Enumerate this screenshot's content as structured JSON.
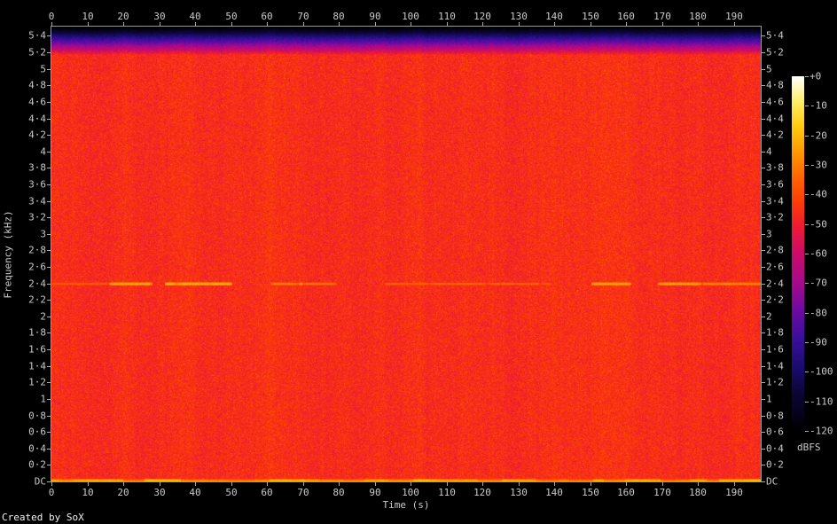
{
  "credit": "Created by SoX",
  "colors": {
    "background": "#000000",
    "axis_line": "#989898",
    "tick": "#aaaaaa",
    "label_text": "#cacaca",
    "credit_text": "#f2f2f2"
  },
  "chart_data": {
    "type": "heatmap",
    "subtype": "audio-spectrogram",
    "title": "",
    "xlabel": "Time (s)",
    "ylabel": "Frequency (kHz)",
    "colorbar_label": "dBFS",
    "x_range_s": [
      0,
      197.5
    ],
    "y_range_khz": [
      0,
      5.5125
    ],
    "colorbar_range_db": [
      0,
      -120
    ],
    "grid": false,
    "noise_floor_dbfs": -46,
    "x_ticks": [
      {
        "label": "0",
        "s": 0
      },
      {
        "label": "10",
        "s": 10
      },
      {
        "label": "20",
        "s": 20
      },
      {
        "label": "30",
        "s": 30
      },
      {
        "label": "40",
        "s": 40
      },
      {
        "label": "50",
        "s": 50
      },
      {
        "label": "60",
        "s": 60
      },
      {
        "label": "70",
        "s": 70
      },
      {
        "label": "80",
        "s": 80
      },
      {
        "label": "90",
        "s": 90
      },
      {
        "label": "100",
        "s": 100
      },
      {
        "label": "110",
        "s": 110
      },
      {
        "label": "120",
        "s": 120
      },
      {
        "label": "130",
        "s": 130
      },
      {
        "label": "140",
        "s": 140
      },
      {
        "label": "150",
        "s": 150
      },
      {
        "label": "160",
        "s": 160
      },
      {
        "label": "170",
        "s": 170
      },
      {
        "label": "180",
        "s": 180
      },
      {
        "label": "190",
        "s": 190
      }
    ],
    "y_ticks": [
      {
        "label": "5·4",
        "khz": 5.4
      },
      {
        "label": "5·2",
        "khz": 5.2
      },
      {
        "label": "5",
        "khz": 5.0
      },
      {
        "label": "4·8",
        "khz": 4.8
      },
      {
        "label": "4·6",
        "khz": 4.6
      },
      {
        "label": "4·4",
        "khz": 4.4
      },
      {
        "label": "4·2",
        "khz": 4.2
      },
      {
        "label": "4",
        "khz": 4.0
      },
      {
        "label": "3·8",
        "khz": 3.8
      },
      {
        "label": "3·6",
        "khz": 3.6
      },
      {
        "label": "3·4",
        "khz": 3.4
      },
      {
        "label": "3·2",
        "khz": 3.2
      },
      {
        "label": "3",
        "khz": 3.0
      },
      {
        "label": "2·8",
        "khz": 2.8
      },
      {
        "label": "2·6",
        "khz": 2.6
      },
      {
        "label": "2·4",
        "khz": 2.4
      },
      {
        "label": "2·2",
        "khz": 2.2
      },
      {
        "label": "2",
        "khz": 2.0
      },
      {
        "label": "1·8",
        "khz": 1.8
      },
      {
        "label": "1·6",
        "khz": 1.6
      },
      {
        "label": "1·4",
        "khz": 1.4
      },
      {
        "label": "1·2",
        "khz": 1.2
      },
      {
        "label": "1",
        "khz": 1.0
      },
      {
        "label": "0·8",
        "khz": 0.8
      },
      {
        "label": "0·6",
        "khz": 0.6
      },
      {
        "label": "0·4",
        "khz": 0.4
      },
      {
        "label": "0·2",
        "khz": 0.2
      },
      {
        "label": "DC",
        "khz": 0
      }
    ],
    "colorbar_ticks": [
      {
        "label": "+0",
        "db": 0
      },
      {
        "label": "-10",
        "db": -10
      },
      {
        "label": "-20",
        "db": -20
      },
      {
        "label": "-30",
        "db": -30
      },
      {
        "label": "-40",
        "db": -40
      },
      {
        "label": "-50",
        "db": -50
      },
      {
        "label": "-60",
        "db": -60
      },
      {
        "label": "-70",
        "db": -70
      },
      {
        "label": "-80",
        "db": -80
      },
      {
        "label": "-90",
        "db": -90
      },
      {
        "label": "-100",
        "db": -100
      },
      {
        "label": "-110",
        "db": -110
      },
      {
        "label": "-120",
        "db": -120
      }
    ],
    "features": [
      {
        "name": "broadband-noise",
        "freq_khz": [
          0,
          5.2
        ],
        "level_dbfs": -46
      },
      {
        "name": "lowpass-rolloff",
        "freq_khz": [
          5.17,
          5.51
        ],
        "level_dbfs_at_top": -120
      },
      {
        "name": "intermittent-tone",
        "freq_khz": 2.4,
        "level_dbfs": -26
      },
      {
        "name": "dc-component",
        "freq_khz": 0,
        "level_dbfs": -23
      }
    ],
    "palette_stops": [
      {
        "p": 0.0,
        "c": "#000000"
      },
      {
        "p": 0.055,
        "c": "#06031f"
      },
      {
        "p": 0.11,
        "c": "#0c0638"
      },
      {
        "p": 0.18,
        "c": "#1b0c70"
      },
      {
        "p": 0.26,
        "c": "#3b0f9a"
      },
      {
        "p": 0.34,
        "c": "#6e0aa2"
      },
      {
        "p": 0.42,
        "c": "#a80a8a"
      },
      {
        "p": 0.5,
        "c": "#cb0b6a"
      },
      {
        "p": 0.58,
        "c": "#f01c30"
      },
      {
        "p": 0.645,
        "c": "#fd3c06"
      },
      {
        "p": 0.7,
        "c": "#ff5b00"
      },
      {
        "p": 0.78,
        "c": "#ff9400"
      },
      {
        "p": 0.86,
        "c": "#ffcc10"
      },
      {
        "p": 0.93,
        "c": "#ffef66"
      },
      {
        "p": 1.0,
        "c": "#ffffff"
      }
    ]
  }
}
